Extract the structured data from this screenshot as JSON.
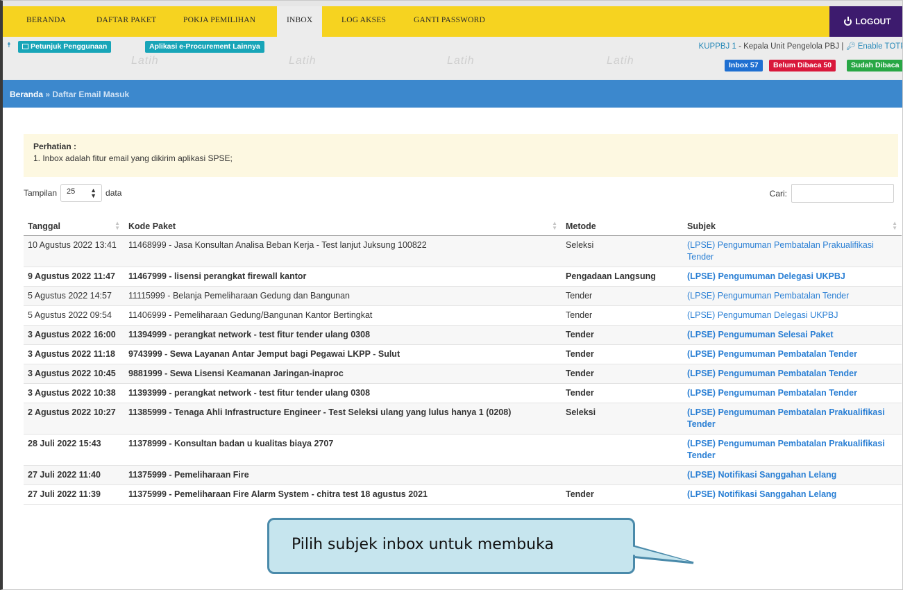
{
  "nav": {
    "items": [
      "BERANDA",
      "DAFTAR PAKET",
      "POKJA PEMILIHAN",
      "INBOX",
      "LOG AKSES",
      "GANTI PASSWORD"
    ],
    "active": "INBOX",
    "logout_label": "LOGOUT"
  },
  "subbar": {
    "btn_petunjuk": "Petunjuk Penggunaan",
    "btn_aplikasi": "Aplikasi e-Procurement Lainnya",
    "user_role": "KUPPBJ 1",
    "user_desc": " - Kepala Unit Pengelola PBJ | ",
    "totp_label": "Enable TOTP",
    "badges": {
      "inbox": "Inbox 57",
      "unread": "Belum Dibaca 50",
      "read": "Sudah Dibaca"
    },
    "badge_colors": {
      "inbox": "#1f6fd1",
      "unread": "#d9183b",
      "read": "#28a745"
    }
  },
  "breadcrumb": {
    "home": "Beranda",
    "sep": "»",
    "current": "Daftar Email Masuk"
  },
  "notice": {
    "title": "Perhatian :",
    "line1": "1. Inbox adalah fitur email yang dikirim aplikasi SPSE;"
  },
  "controls": {
    "show_label": "Tampilan",
    "page_size": "25",
    "data_label": "data",
    "search_label": "Cari:"
  },
  "table": {
    "headers": [
      "Tanggal",
      "Kode Paket",
      "Metode",
      "Subjek"
    ],
    "rows": [
      {
        "date": "10 Agustus 2022 13:41",
        "kode": "11468999 - Jasa Konsultan Analisa Beban Kerja - Test lanjut Juksung 100822",
        "metode": "Seleksi",
        "subjek": "(LPSE) Pengumuman Pembatalan Prakualifikasi Tender",
        "bold": false
      },
      {
        "date": "9 Agustus 2022 11:47",
        "kode": "11467999 - lisensi perangkat firewall kantor",
        "metode": "Pengadaan Langsung",
        "subjek": "(LPSE) Pengumuman Delegasi UKPBJ",
        "bold": true
      },
      {
        "date": "5 Agustus 2022 14:57",
        "kode": "11115999 - Belanja Pemeliharaan Gedung dan Bangunan",
        "metode": "Tender",
        "subjek": "(LPSE) Pengumuman Pembatalan Tender",
        "bold": false
      },
      {
        "date": "5 Agustus 2022 09:54",
        "kode": "11406999 - Pemeliharaan Gedung/Bangunan Kantor Bertingkat",
        "metode": "Tender",
        "subjek": "(LPSE) Pengumuman Delegasi UKPBJ",
        "bold": false
      },
      {
        "date": "3 Agustus 2022 16:00",
        "kode": "11394999 - perangkat network - test fitur tender ulang 0308",
        "metode": "Tender",
        "subjek": "(LPSE) Pengumuman Selesai Paket",
        "bold": true
      },
      {
        "date": "3 Agustus 2022 11:18",
        "kode": "9743999 - Sewa Layanan Antar Jemput bagi Pegawai LKPP - Sulut",
        "metode": "Tender",
        "subjek": "(LPSE) Pengumuman Pembatalan Tender",
        "bold": true
      },
      {
        "date": "3 Agustus 2022 10:45",
        "kode": "9881999 - Sewa Lisensi Keamanan Jaringan-inaproc",
        "metode": "Tender",
        "subjek": "(LPSE) Pengumuman Pembatalan Tender",
        "bold": true
      },
      {
        "date": "3 Agustus 2022 10:38",
        "kode": "11393999 - perangkat network - test fitur tender ulang 0308",
        "metode": "Tender",
        "subjek": "(LPSE) Pengumuman Pembatalan Tender",
        "bold": true
      },
      {
        "date": "2 Agustus 2022 10:27",
        "kode": "11385999 - Tenaga Ahli Infrastructure Engineer - Test Seleksi ulang yang lulus hanya 1 (0208)",
        "metode": "Seleksi",
        "subjek": "(LPSE) Pengumuman Pembatalan Prakualifikasi Tender",
        "bold": true
      },
      {
        "date": "28 Juli 2022 15:43",
        "kode": "11378999 - Konsultan badan u kualitas biaya 2707",
        "metode": "",
        "subjek": "(LPSE) Pengumuman Pembatalan Prakualifikasi Tender",
        "bold": true
      },
      {
        "date": "27 Juli 2022 11:40",
        "kode": "11375999 - Pemeliharaan Fire",
        "metode": "",
        "subjek": "(LPSE) Notifikasi Sanggahan Lelang",
        "bold": true
      },
      {
        "date": "27 Juli 2022 11:39",
        "kode": "11375999 - Pemeliharaan Fire Alarm System - chitra test 18 agustus 2021",
        "metode": "Tender",
        "subjek": "(LPSE) Notifikasi Sanggahan Lelang",
        "bold": true
      }
    ]
  },
  "callout": {
    "text": "Pilih subjek inbox untuk membuka"
  }
}
